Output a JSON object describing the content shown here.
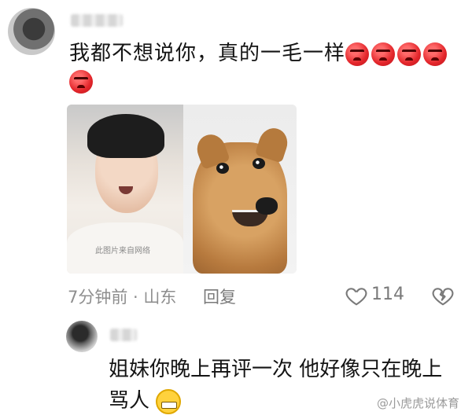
{
  "comment": {
    "username": "",
    "text": "我都不想说你，真的一毛一样",
    "emoji": [
      "angry-face-emoji",
      "angry-face-emoji",
      "angry-face-emoji",
      "angry-face-emoji",
      "angry-face-emoji"
    ],
    "image_watermark": "此图片来自网络",
    "meta": {
      "time_location": "7分钟前 · 山东",
      "reply_label": "回复",
      "like_count": "114"
    }
  },
  "reply": {
    "username": "",
    "text_line1": "姐妹你晚上再评一次 他好像只在晚上",
    "text_line2": "骂人",
    "emoji": "grinning-face-emoji"
  },
  "watermark": {
    "text": "@小虎虎说体育"
  },
  "colors": {
    "accent": "#e3262b",
    "meta_gray": "#8e8e8e"
  }
}
